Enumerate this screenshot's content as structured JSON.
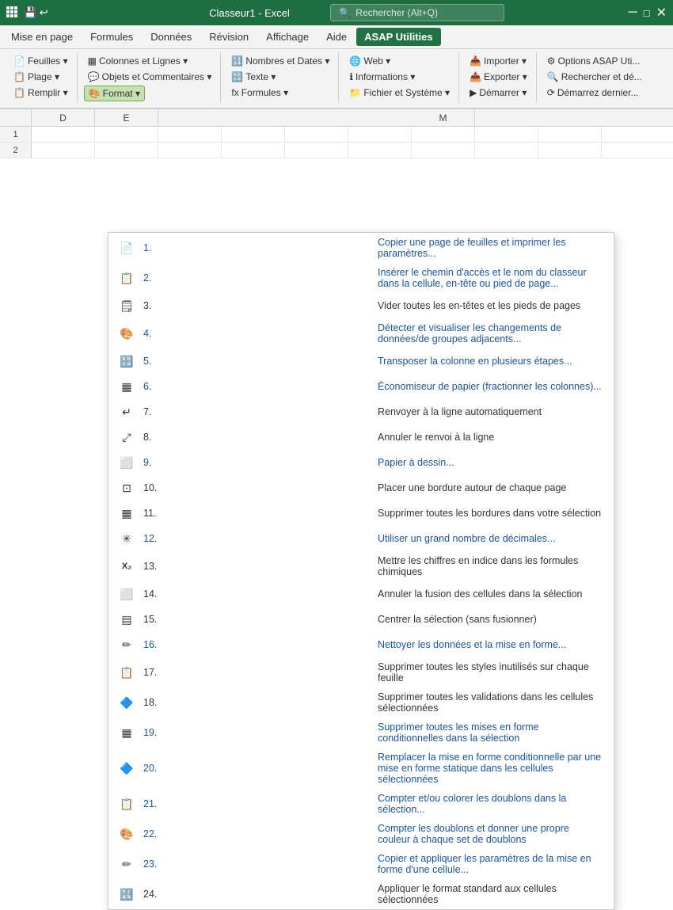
{
  "titlebar": {
    "app_name": "Classeur1 - Excel",
    "search_placeholder": "Rechercher (Alt+Q)"
  },
  "menubar": {
    "items": [
      {
        "label": "Mise en page",
        "active": false
      },
      {
        "label": "Formules",
        "active": false
      },
      {
        "label": "Données",
        "active": false
      },
      {
        "label": "Révision",
        "active": false
      },
      {
        "label": "Affichage",
        "active": false
      },
      {
        "label": "Aide",
        "active": false
      },
      {
        "label": "ASAP Utilities",
        "active": true
      }
    ]
  },
  "ribbon": {
    "groups": [
      {
        "buttons": [
          {
            "label": "Feuilles ▾"
          },
          {
            "label": "Plage ▾"
          },
          {
            "label": "Remplir ▾"
          }
        ]
      },
      {
        "buttons": [
          {
            "label": "Colonnes et Lignes ▾"
          },
          {
            "label": "Objets et Commentaires ▾"
          },
          {
            "label": "Format ▾",
            "active": true
          }
        ]
      },
      {
        "buttons": [
          {
            "label": "Nombres et Dates ▾"
          },
          {
            "label": "Texte ▾"
          },
          {
            "label": "Formules ▾"
          }
        ]
      },
      {
        "buttons": [
          {
            "label": "Web ▾"
          },
          {
            "label": "Informations ▾"
          },
          {
            "label": "Fichier et Système ▾"
          }
        ]
      },
      {
        "buttons": [
          {
            "label": "Importer ▾"
          },
          {
            "label": "Exporter ▾"
          },
          {
            "label": "Démarrer ▾"
          }
        ]
      },
      {
        "buttons": [
          {
            "label": "Options ASAP Uti..."
          },
          {
            "label": "Rechercher et dé..."
          },
          {
            "label": "Démarrez dernier..."
          }
        ]
      }
    ]
  },
  "col_headers": [
    "D",
    "E",
    "M"
  ],
  "dropdown": {
    "items": [
      {
        "num": "1.",
        "text": "Copier une page de feuilles et imprimer les paramètres...",
        "icon": "📄"
      },
      {
        "num": "2.",
        "text": "Insérer le chemin d'accès et le nom du classeur dans la cellule, en-tête ou pied de page...",
        "icon": "📋"
      },
      {
        "num": "3.",
        "text": "Vider toutes les en-têtes et les pieds de pages",
        "icon": "🗒"
      },
      {
        "num": "4.",
        "text": "Détecter et visualiser les changements de données/de groupes adjacents...",
        "icon": "🎨"
      },
      {
        "num": "5.",
        "text": "Transposer la colonne en plusieurs étapes...",
        "icon": "🔡"
      },
      {
        "num": "6.",
        "text": "Économiseur de papier (fractionner les colonnes)...",
        "icon": "▦"
      },
      {
        "num": "7.",
        "text": "Renvoyer à la ligne automatiquement",
        "icon": "↵"
      },
      {
        "num": "8.",
        "text": "Annuler le renvoi à la ligne",
        "icon": "⤢"
      },
      {
        "num": "9.",
        "text": "Papier à dessin...",
        "icon": "⬜"
      },
      {
        "num": "10.",
        "text": "Placer une bordure autour de chaque page",
        "icon": "⊡"
      },
      {
        "num": "11.",
        "text": "Supprimer toutes les bordures dans votre sélection",
        "icon": "▦"
      },
      {
        "num": "12.",
        "text": "Utiliser un grand nombre de décimales...",
        "icon": "✳"
      },
      {
        "num": "13.",
        "text": "Mettre les chiffres en indice dans les formules chimiques",
        "icon": "X₂"
      },
      {
        "num": "14.",
        "text": "Annuler la fusion des cellules dans la sélection",
        "icon": "⬜"
      },
      {
        "num": "15.",
        "text": "Centrer la sélection (sans fusionner)",
        "icon": "▤"
      },
      {
        "num": "16.",
        "text": "Nettoyer les données et la mise en forme...",
        "icon": "✏"
      },
      {
        "num": "17.",
        "text": "Supprimer toutes les  styles inutilisés sur chaque feuille",
        "icon": "📋"
      },
      {
        "num": "18.",
        "text": "Supprimer toutes les validations dans les cellules sélectionnées",
        "icon": "🔷"
      },
      {
        "num": "19.",
        "text": "Supprimer toutes les mises en forme conditionnelles dans la sélection",
        "icon": "▦"
      },
      {
        "num": "20.",
        "text": "Remplacer la mise en forme conditionnelle par une mise en forme statique dans les cellules sélectionnées",
        "icon": "🔷"
      },
      {
        "num": "21.",
        "text": "Compter et/ou colorer les doublons dans la sélection...",
        "icon": "📋"
      },
      {
        "num": "22.",
        "text": "Compter les doublons et donner une propre couleur à chaque set de doublons",
        "icon": "🎨"
      },
      {
        "num": "23.",
        "text": "Copier et appliquer les paramètres de la mise en forme d'une cellule...",
        "icon": "✏"
      },
      {
        "num": "24.",
        "text": "Appliquer le format standard aux cellules sélectionnées",
        "icon": "🔣"
      }
    ]
  }
}
